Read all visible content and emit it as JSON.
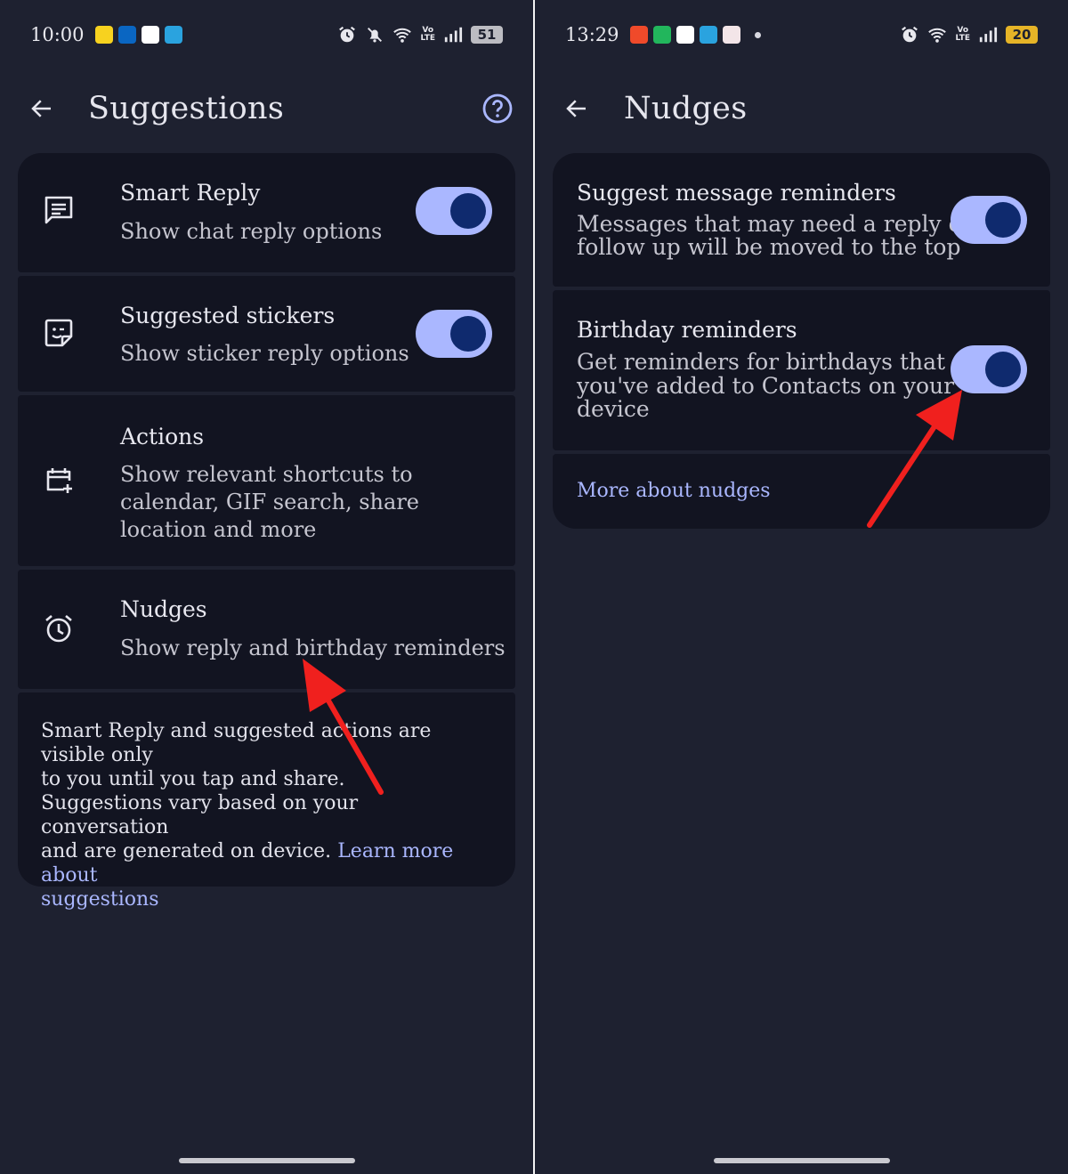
{
  "left": {
    "status": {
      "time": "10:00",
      "battery": "51",
      "volte_top": "Vo",
      "volte_bottom": "LTE"
    },
    "title": "Suggestions",
    "rows": [
      {
        "title": "Smart Reply",
        "subtitle": "Show chat reply options",
        "toggle_on": true
      },
      {
        "title": "Suggested stickers",
        "subtitle": "Show sticker reply options",
        "toggle_on": true
      },
      {
        "title": "Actions",
        "subtitle_lines": [
          "Show relevant shortcuts to",
          "calendar, GIF search, share",
          "location and more"
        ]
      },
      {
        "title": "Nudges",
        "subtitle": "Show reply and birthday reminders"
      }
    ],
    "info": {
      "p1_lines": [
        "Smart Reply and suggested actions are visible only",
        "to you until you tap and share."
      ],
      "p2_line1": "Suggestions vary based on your conversation",
      "p2_line2": "and are generated on device.",
      "link_line1": "Learn more about",
      "link_line2": "suggestions"
    }
  },
  "right": {
    "status": {
      "time": "13:29",
      "battery": "20",
      "volte_top": "Vo",
      "volte_bottom": "LTE"
    },
    "title": "Nudges",
    "rows": [
      {
        "title": "Suggest message reminders",
        "subtitle_lines": [
          "Messages that may need a reply or",
          "follow up will be moved to the top"
        ],
        "toggle_on": true
      },
      {
        "title": "Birthday reminders",
        "subtitle_lines": [
          "Get reminders for birthdays that",
          "you've added to Contacts on your",
          "device"
        ],
        "toggle_on": true
      }
    ],
    "more_link": "More about nudges"
  },
  "colors": {
    "background": "#1e2130",
    "card": "#121421",
    "toggle_track": "#aab7ff",
    "toggle_knob": "#0f2a6e",
    "link": "#aab7ff",
    "annotation_arrow": "#f0201e"
  }
}
